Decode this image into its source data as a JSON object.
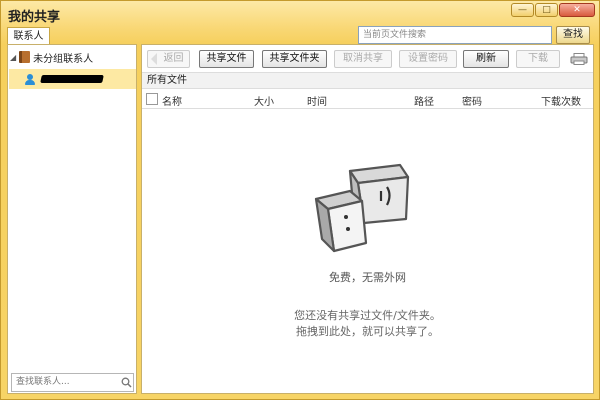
{
  "window": {
    "title": "我的共享",
    "minimize_glyph": "—",
    "maximize_glyph": "□",
    "close_glyph": "✕"
  },
  "tabs": {
    "contacts": "联系人"
  },
  "top_search": {
    "placeholder": "当前页文件搜索",
    "button": "查找"
  },
  "sidebar": {
    "group_label": "未分组联系人",
    "contact_name_redacted": true,
    "search_placeholder": "查找联系人..."
  },
  "toolbar": {
    "back": "返回",
    "share_file": "共享文件",
    "share_folder": "共享文件夹",
    "cancel_share": "取消共享",
    "set_password": "设置密码",
    "refresh": "刷新",
    "download": "下载"
  },
  "path_bar": "所有文件",
  "columns": [
    "名称",
    "大小",
    "时间",
    "路径",
    "密码",
    "下载次数"
  ],
  "empty_state": {
    "title": "免费，无需外网",
    "line1": "您还没有共享过文件/文件夹。",
    "line2": "拖拽到此处，就可以共享了。"
  },
  "colors": {
    "titlebar": "#f9d877",
    "selected_row": "#fde9a3",
    "accent_blue": "#2b8ed6"
  }
}
